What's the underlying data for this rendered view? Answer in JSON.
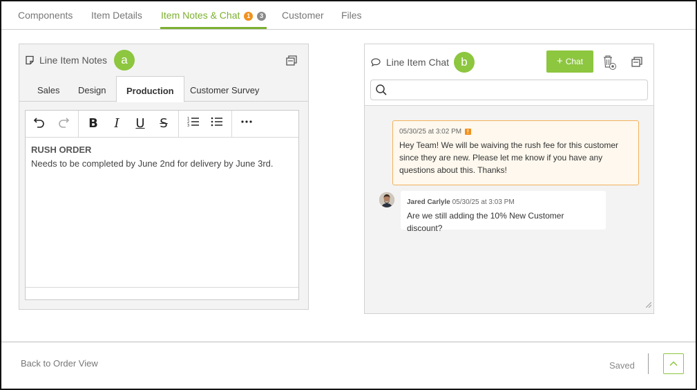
{
  "tabs": [
    {
      "label": "Components"
    },
    {
      "label": "Item Details"
    },
    {
      "label": "Item Notes & Chat",
      "badge_orange": "1",
      "badge_grey": "3"
    },
    {
      "label": "Customer"
    },
    {
      "label": "Files"
    }
  ],
  "notes": {
    "title": "Line Item Notes",
    "marker": "a",
    "tabs": [
      "Sales",
      "Design",
      "Production",
      "Customer Survey"
    ],
    "active_tab": "Production",
    "content_heading": "RUSH ORDER",
    "content_text": "Needs to be completed by June 2nd for delivery by June 3rd."
  },
  "chat": {
    "title": "Line Item Chat",
    "marker": "b",
    "new_chat_label": "Chat",
    "search_placeholder": "",
    "messages": [
      {
        "meta": "05/30/25 at 3:02 PM",
        "alert": "!",
        "text": "Hey Team! We will be waiving the rush fee for this customer since they are new. Please let me know if you have any questions about this. Thanks!"
      },
      {
        "author": "Jared Carlyle",
        "meta": "05/30/25 at 3:03 PM",
        "text": "Are we still adding the 10% New Customer discount?"
      }
    ]
  },
  "footer": {
    "back_label": "Back to Order View",
    "status": "Saved"
  },
  "colors": {
    "accent": "#8dc63f",
    "accent_text": "#7cb030",
    "alert": "#f0921e"
  }
}
